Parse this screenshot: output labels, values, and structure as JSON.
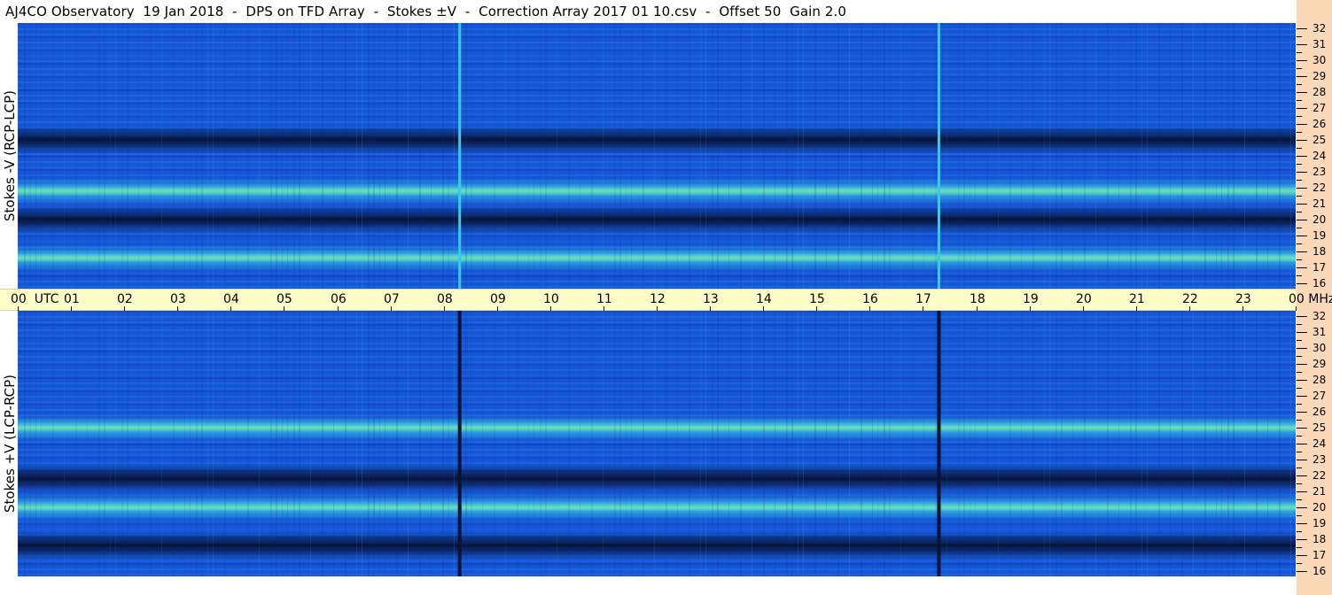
{
  "header": {
    "title": "AJ4CO Observatory  19 Jan 2018  -  DPS on TFD Array  -  Stokes ±V  -  Correction Array 2017 01 10.csv  -  Offset 50  Gain 2.0"
  },
  "chart_data": [
    {
      "type": "heatmap",
      "panel": "top",
      "ylabel": "Stokes -V (RCP-LCP)",
      "x_range": [
        "00 UTC",
        "00"
      ],
      "ylim": [
        16,
        32
      ],
      "y_unit": "MHz",
      "colormap": [
        "#081338",
        "#0a2a9a",
        "#1656d6",
        "#2a8cf0",
        "#3cc8e8",
        "#8ef08a",
        "#f0e640",
        "#f02020"
      ],
      "features": {
        "dark_bands_mhz": [
          25.0,
          20.0
        ],
        "bright_bands_mhz": [
          21.8,
          17.6
        ],
        "vertical_lines_utc": [
          8.3,
          17.3
        ],
        "vertical_line_color": "bright"
      }
    },
    {
      "type": "heatmap",
      "panel": "bottom",
      "ylabel": "Stokes +V (LCP-RCP)",
      "x_range": [
        "00 UTC",
        "00"
      ],
      "ylim": [
        16,
        32
      ],
      "y_unit": "MHz",
      "colormap": [
        "#081338",
        "#0a2a9a",
        "#1656d6",
        "#2a8cf0",
        "#3cc8e8",
        "#8ef08a",
        "#f0e640",
        "#f02020"
      ],
      "features": {
        "dark_bands_mhz": [
          21.8,
          17.6
        ],
        "bright_bands_mhz": [
          25.0,
          20.0
        ],
        "vertical_lines_utc": [
          8.3,
          17.3
        ],
        "vertical_line_color": "dark"
      }
    }
  ],
  "time_axis": {
    "labels": [
      "00  UTC",
      "01",
      "02",
      "03",
      "04",
      "05",
      "06",
      "07",
      "08",
      "09",
      "10",
      "11",
      "12",
      "13",
      "14",
      "15",
      "16",
      "17",
      "18",
      "19",
      "20",
      "21",
      "22",
      "23",
      "00 MHz"
    ]
  },
  "freq_axis": {
    "labels": [
      "32",
      "31",
      "30",
      "29",
      "28",
      "27",
      "26",
      "25",
      "24",
      "23",
      "22",
      "21",
      "20",
      "19",
      "18",
      "17",
      "16"
    ]
  }
}
